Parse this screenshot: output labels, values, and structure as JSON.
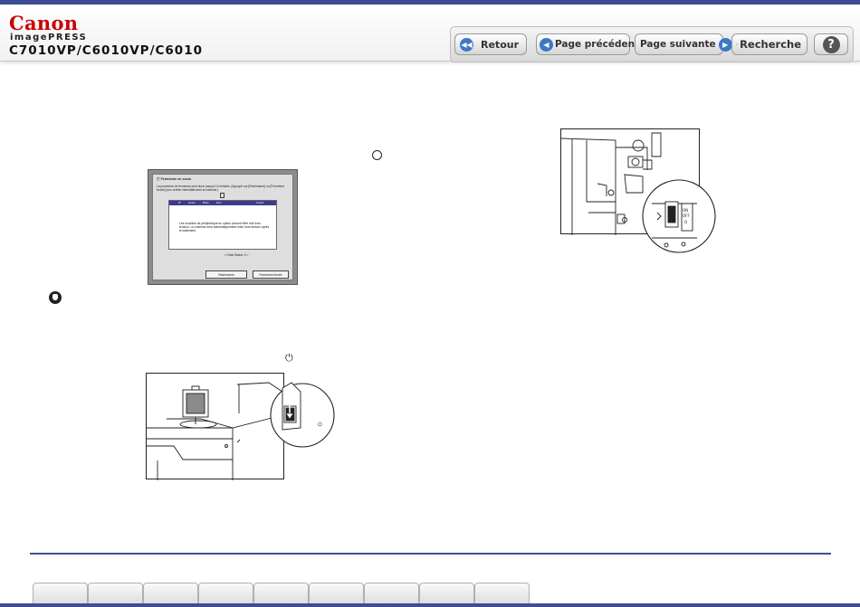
{
  "header": {
    "brand": "Canon",
    "product": "imagePRESS",
    "model": "C7010VP/C6010VP/C6010"
  },
  "nav": {
    "retour": "Retour",
    "previous": "Page précédente",
    "next": "Page suivante",
    "search": "Recherche",
    "help": "?"
  },
  "screen": {
    "title": "Fermeture en cours",
    "message": "La procédure de fermeture peut durer jusqu'à 10 minutes. (Appuyer sur [Redémarrer] ou [Fermeture forcée] pour arrêter immédiatement la machine.)",
    "columns": [
      "N°",
      "Heure",
      "Mode",
      "Nom",
      "Travail"
    ],
    "body": "Les modules de périphérique en option peuvent être mis hors tension. La machine sera automatiquement mise hors tension après le traitement.",
    "total": "< Total Statut: 0 >",
    "btn_restart": "Redémarrer",
    "btn_forced": "Fermeture forcée"
  },
  "icons": {
    "important": "important-icon",
    "power": "power-icon",
    "circle": "circle-icon"
  },
  "footer": {
    "tab_count": 9
  }
}
